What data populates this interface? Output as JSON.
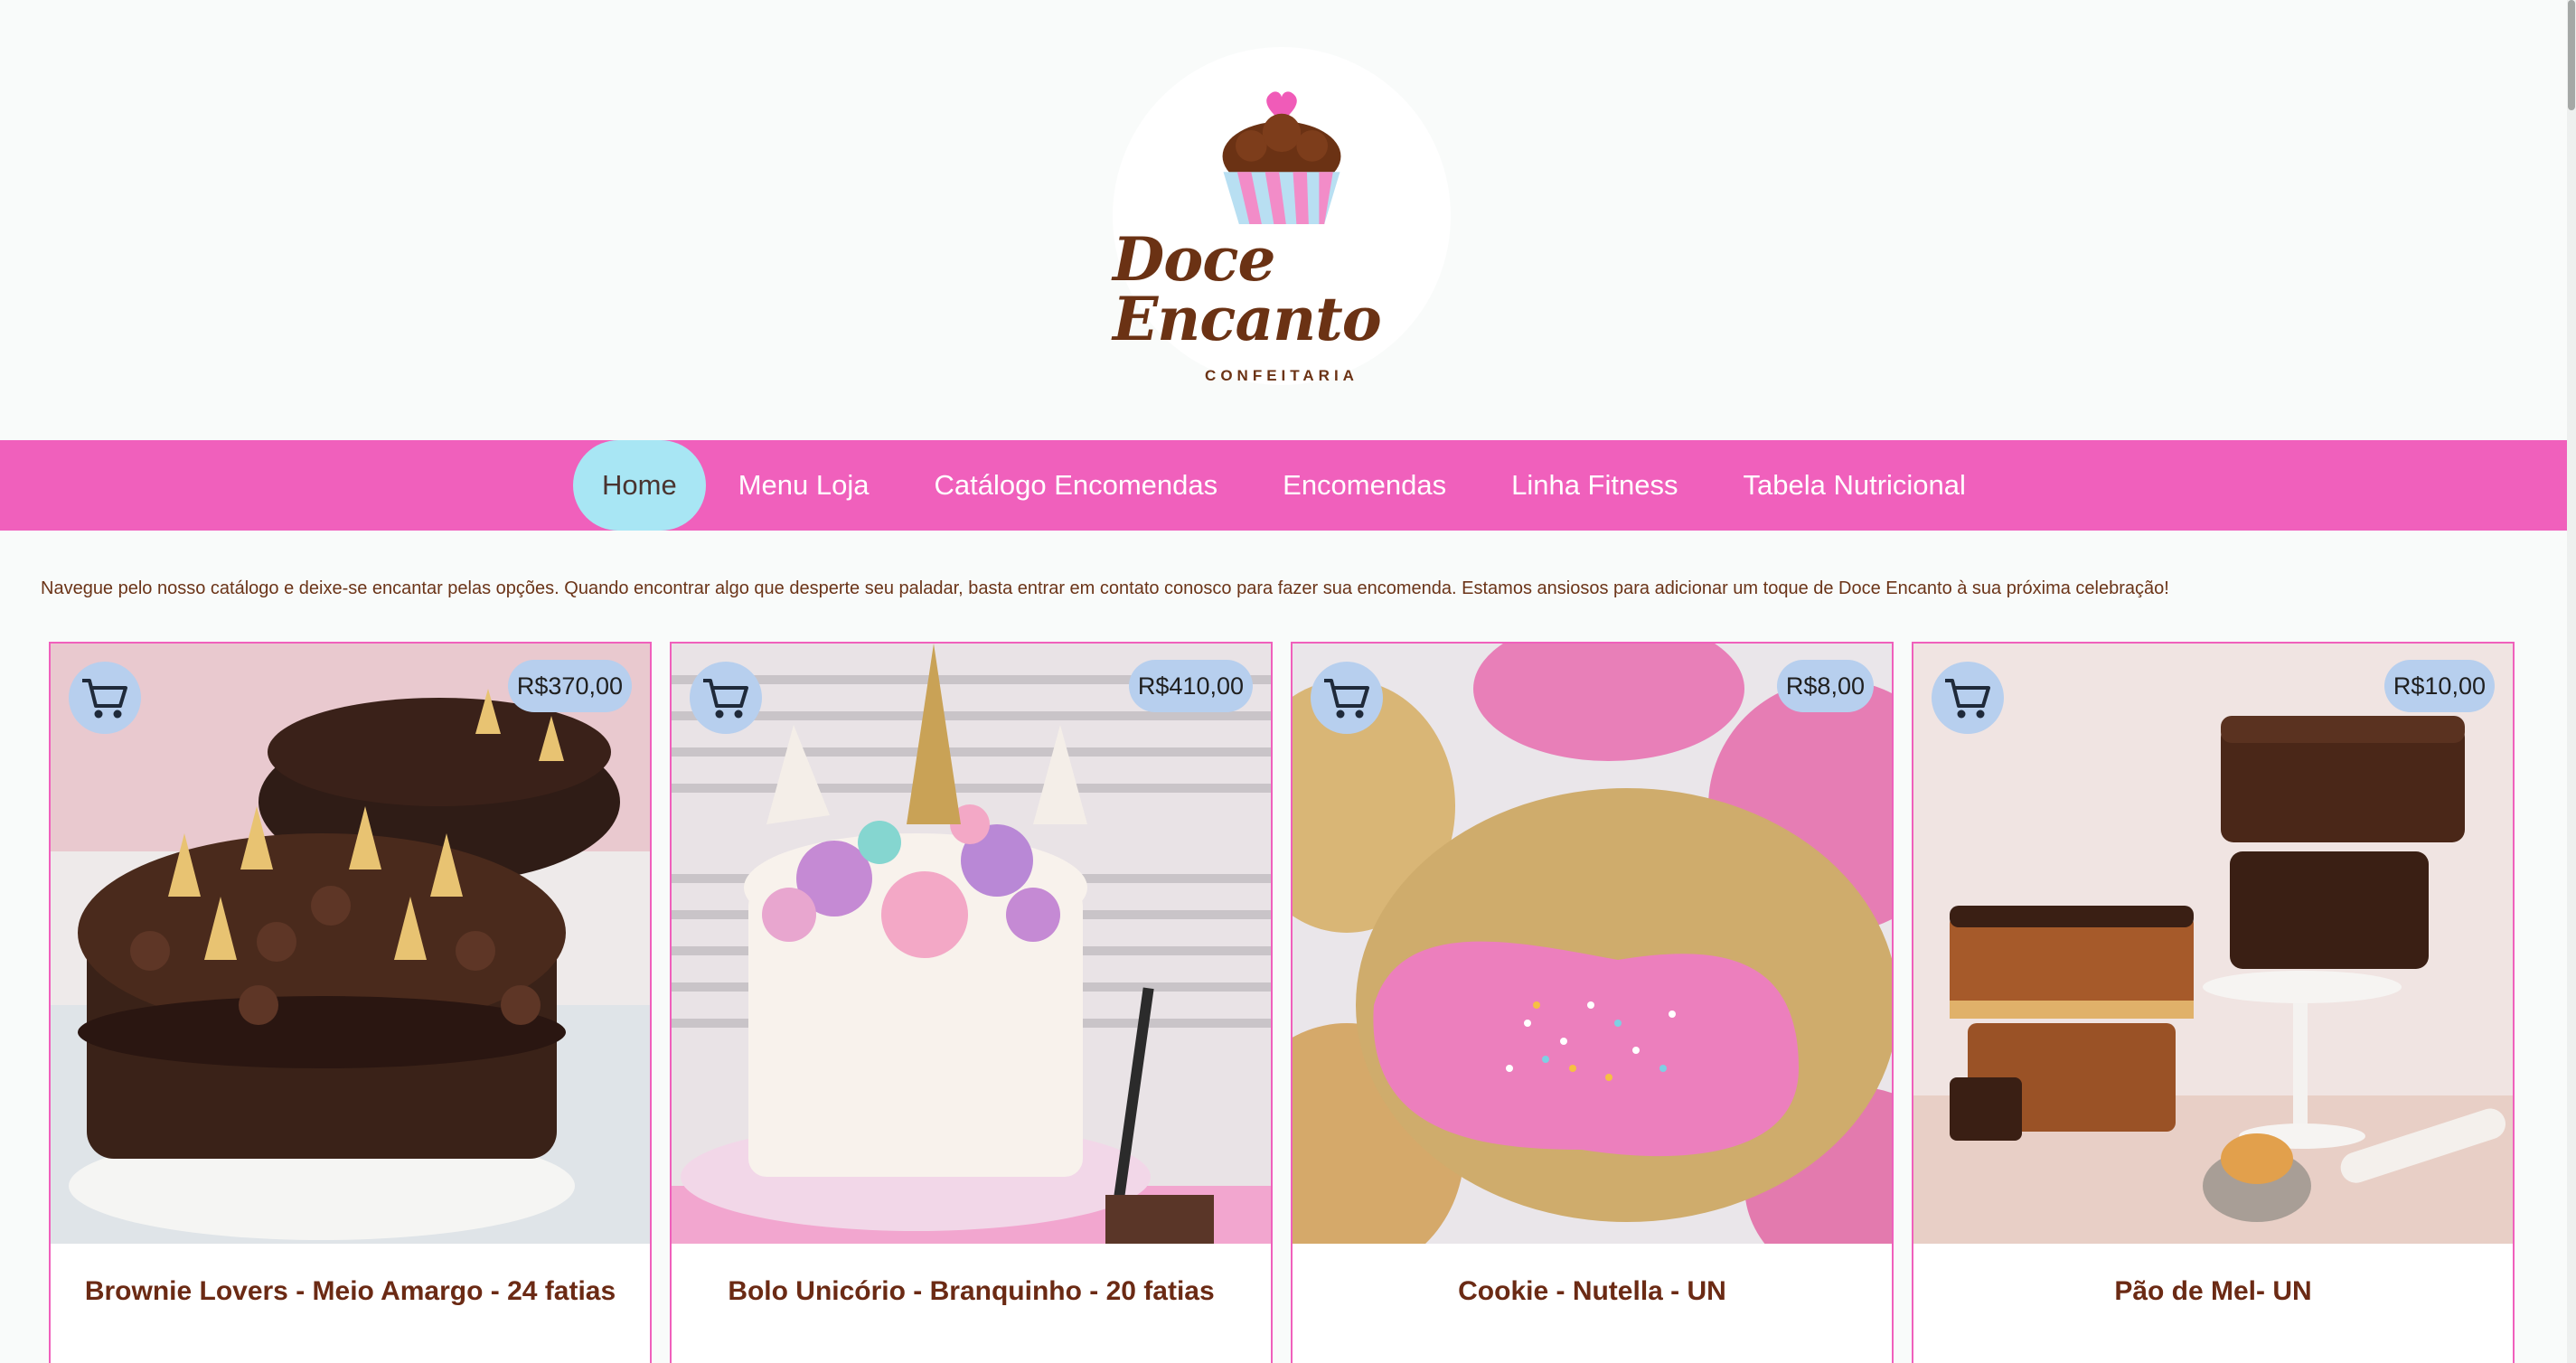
{
  "brand": {
    "name": "Doce Encanto",
    "subtitle": "CONFEITARIA",
    "colors": {
      "pink": "#f060bc",
      "active": "#a8e6f4",
      "brown": "#6b3214",
      "badge": "#b7cfee"
    }
  },
  "nav": {
    "items": [
      {
        "label": "Home",
        "active": true
      },
      {
        "label": "Menu Loja",
        "active": false
      },
      {
        "label": "Catálogo Encomendas",
        "active": false
      },
      {
        "label": "Encomendas",
        "active": false
      },
      {
        "label": "Linha Fitness",
        "active": false
      },
      {
        "label": "Tabela Nutricional",
        "active": false
      }
    ]
  },
  "intro": "Navegue pelo nosso catálogo e deixe-se encantar pelas opções. Quando encontrar algo que desperte seu paladar, basta entrar em contato conosco para fazer sua encomenda. Estamos ansiosos para adicionar um toque de Doce Encanto à sua próxima celebração!",
  "products": [
    {
      "title": "Brownie Lovers - Meio Amargo - 24 fatias",
      "price": "R$370,00",
      "cart_icon": "cart-icon",
      "image": "brownie-cake-photo"
    },
    {
      "title": "Bolo Unicório - Branquinho - 20 fatias",
      "price": "R$410,00",
      "cart_icon": "cart-icon",
      "image": "unicorn-cake-photo"
    },
    {
      "title": "Cookie - Nutella - UN",
      "price": "R$8,00",
      "cart_icon": "cart-icon",
      "image": "pink-cookie-photo"
    },
    {
      "title": "Pão de Mel- UN",
      "price": "R$10,00",
      "cart_icon": "cart-icon",
      "image": "honey-bread-photo"
    }
  ]
}
